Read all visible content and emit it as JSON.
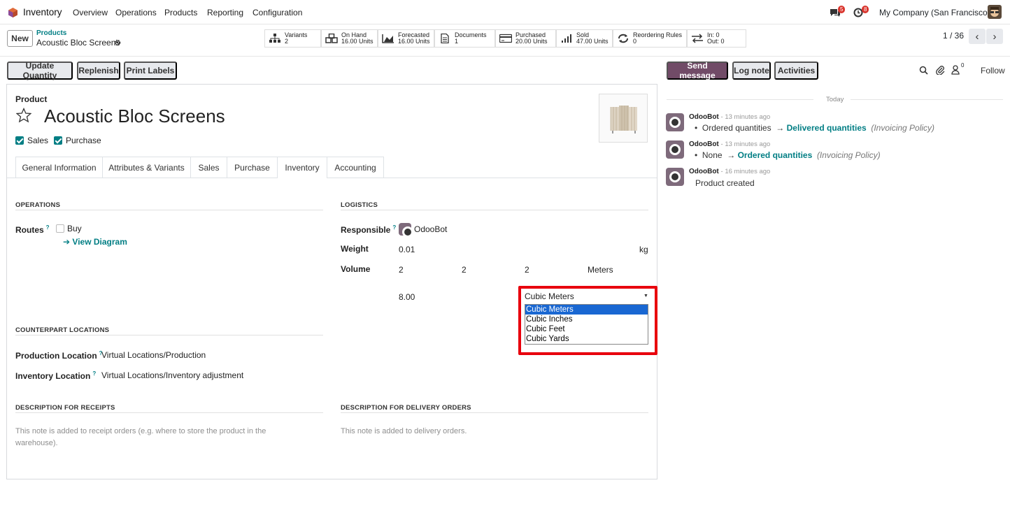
{
  "nav": {
    "app_name": "Inventory",
    "menu": [
      "Overview",
      "Operations",
      "Products",
      "Reporting",
      "Configuration"
    ],
    "messages_count": "5",
    "activities_count": "8",
    "company": "My Company (San Francisco)"
  },
  "control": {
    "new_label": "New",
    "breadcrumb_parent": "Products",
    "breadcrumb_current": "Acoustic Bloc Screens",
    "pager": "1 / 36"
  },
  "smart_buttons": [
    {
      "label": "Variants",
      "value": "2",
      "icon": "sitemap-icon"
    },
    {
      "label": "On Hand",
      "value": "16.00 Units",
      "icon": "cubes-icon"
    },
    {
      "label": "Forecasted",
      "value": "16.00 Units",
      "icon": "area-chart-icon"
    },
    {
      "label": "Documents",
      "value": "1",
      "icon": "file-icon"
    },
    {
      "label": "Purchased",
      "value": "20.00 Units",
      "icon": "credit-card-icon"
    },
    {
      "label": "Sold",
      "value": "47.00 Units",
      "icon": "bar-chart-icon"
    },
    {
      "label": "Reordering Rules",
      "value": "0",
      "icon": "refresh-icon"
    },
    {
      "label": "In: 0",
      "value": "Out: 0",
      "icon": "exchange-icon"
    }
  ],
  "actions": {
    "update_quantity": "Update Quantity",
    "replenish": "Replenish",
    "print_labels": "Print Labels"
  },
  "chatter": {
    "send_message": "Send message",
    "log_note": "Log note",
    "activities": "Activities",
    "followers_count": "0",
    "follow": "Follow",
    "today": "Today",
    "messages": [
      {
        "author": "OdooBot",
        "time": "- 13 minutes ago",
        "old": "Ordered quantities",
        "new": "Delivered quantities",
        "field": "(Invoicing Policy)"
      },
      {
        "author": "OdooBot",
        "time": "- 13 minutes ago",
        "old": "None",
        "new": "Ordered quantities",
        "field": "(Invoicing Policy)"
      },
      {
        "author": "OdooBot",
        "time": "- 16 minutes ago",
        "body": "Product created"
      }
    ]
  },
  "product": {
    "label": "Product",
    "name": "Acoustic Bloc Screens",
    "sales_label": "Sales",
    "purchase_label": "Purchase"
  },
  "tabs": [
    "General Information",
    "Attributes & Variants",
    "Sales",
    "Purchase",
    "Inventory",
    "Accounting"
  ],
  "operations": {
    "title": "OPERATIONS",
    "routes_label": "Routes",
    "route_buy": "Buy",
    "view_diagram": "View Diagram"
  },
  "logistics": {
    "title": "LOGISTICS",
    "responsible_label": "Responsible",
    "responsible_value": "OdooBot",
    "weight_label": "Weight",
    "weight_value": "0.01",
    "weight_unit": "kg",
    "volume_label": "Volume",
    "dim1": "2",
    "dim2": "2",
    "dim3": "2",
    "dim_unit": "Meters",
    "volume_value": "8.00",
    "volume_unit_selected": "Cubic Meters",
    "volume_unit_options": [
      "Cubic Meters",
      "Cubic Inches",
      "Cubic Feet",
      "Cubic Yards"
    ]
  },
  "counterpart": {
    "title": "COUNTERPART LOCATIONS",
    "production_label": "Production Location",
    "production_value": "Virtual Locations/Production",
    "inventory_label": "Inventory Location",
    "inventory_value": "Virtual Locations/Inventory adjustment"
  },
  "descriptions": {
    "receipts_title": "DESCRIPTION FOR RECEIPTS",
    "receipts_placeholder": "This note is added to receipt orders (e.g. where to store the product in the warehouse).",
    "delivery_title": "DESCRIPTION FOR DELIVERY ORDERS",
    "delivery_placeholder": "This note is added to delivery orders."
  },
  "colors": {
    "brand": "#714b67",
    "accent": "#017e84",
    "highlight": "#e8000d",
    "option_selected": "#1967d2"
  }
}
